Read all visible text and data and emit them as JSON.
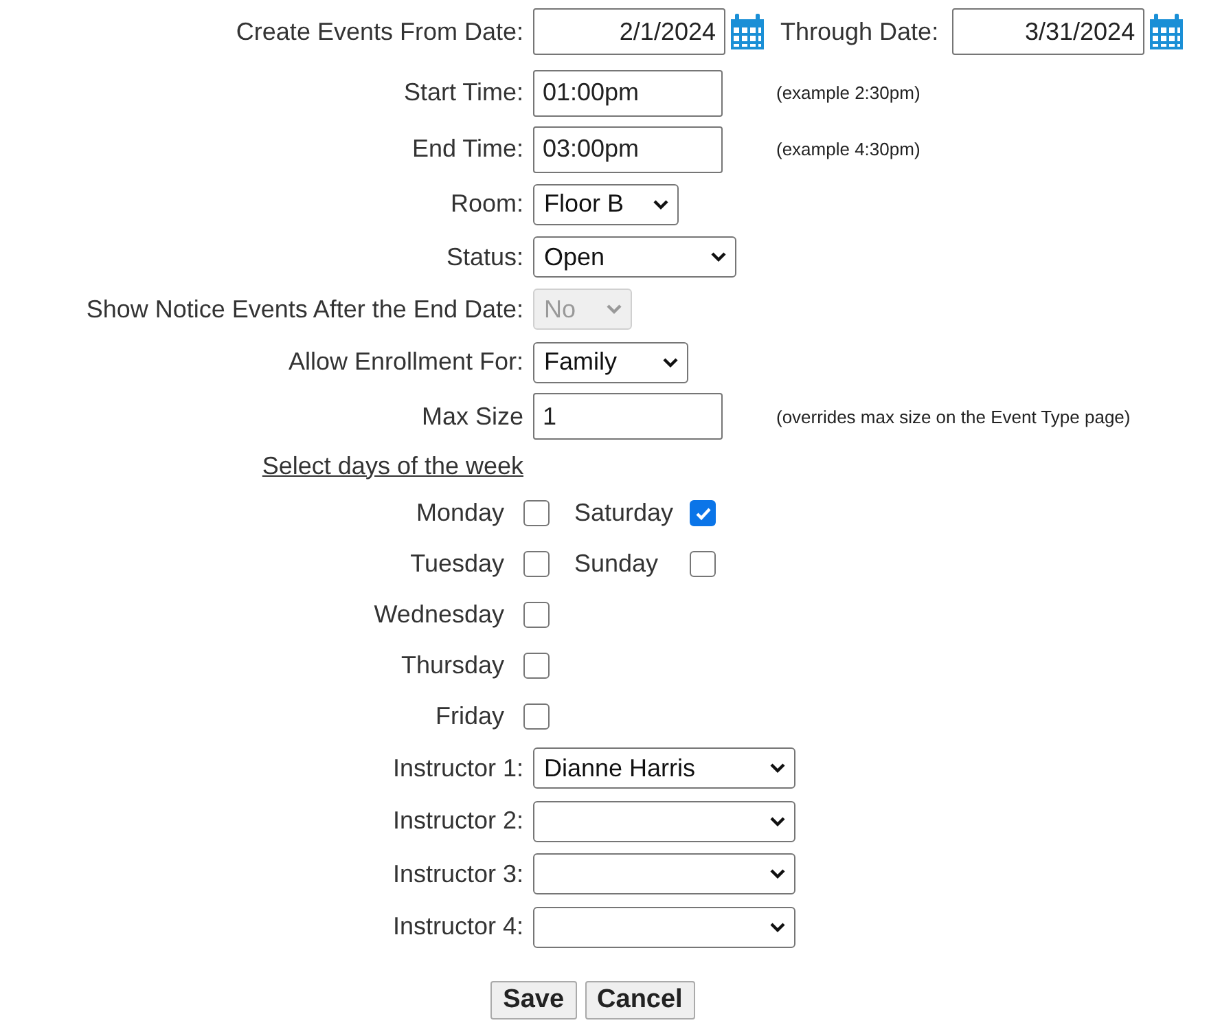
{
  "date_range": {
    "from_label": "Create Events From Date:",
    "from_value": "2/1/2024",
    "through_label": "Through Date:",
    "through_value": "3/31/2024"
  },
  "fields": [
    {
      "kind": "text",
      "label": "Start Time:",
      "value": "01:00pm",
      "hint": "(example 2:30pm)"
    },
    {
      "kind": "text",
      "label": "End Time:",
      "value": "03:00pm",
      "hint": "(example 4:30pm)"
    },
    {
      "kind": "select",
      "label": "Room:",
      "value": "Floor B",
      "disabled": false
    },
    {
      "kind": "select",
      "label": "Status:",
      "value": "Open",
      "disabled": false
    },
    {
      "kind": "select",
      "label": "Show Notice Events After the End Date:",
      "value": "No",
      "disabled": true
    },
    {
      "kind": "select",
      "label": "Allow Enrollment For:",
      "value": "Family",
      "disabled": false
    },
    {
      "kind": "text",
      "label": "Max Size",
      "value": "1",
      "hint": "(overrides max size on the Event Type page)"
    }
  ],
  "days_heading": "Select days of the week",
  "days": [
    {
      "label": "Monday",
      "checked": false
    },
    {
      "label": "Tuesday",
      "checked": false
    },
    {
      "label": "Wednesday",
      "checked": false
    },
    {
      "label": "Thursday",
      "checked": false
    },
    {
      "label": "Friday",
      "checked": false
    },
    {
      "label": "Saturday",
      "checked": true
    },
    {
      "label": "Sunday",
      "checked": false
    }
  ],
  "instructors": [
    {
      "label": "Instructor 1:",
      "value": "Dianne Harris"
    },
    {
      "label": "Instructor 2:"
    },
    {
      "label": "Instructor 3:"
    },
    {
      "label": "Instructor 4:"
    }
  ],
  "buttons": [
    "Save",
    "Cancel"
  ]
}
